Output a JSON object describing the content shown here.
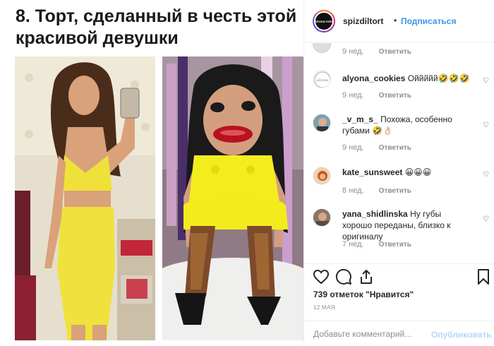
{
  "article": {
    "headline_line1": "8. Торт, сделанный в честь этой",
    "headline_line2": "красивой девушки"
  },
  "post": {
    "username": "spizdiltort",
    "dot": "•",
    "follow_label": "Подписаться",
    "avatar_text": "SPIZDILTORT"
  },
  "comments": [
    {
      "username": "",
      "text": "",
      "time": "9 нед.",
      "reply": "Ответить"
    },
    {
      "username": "alyona_cookies",
      "text": "Оййййй🤣🤣🤣",
      "time": "9 нед.",
      "reply": "Ответить"
    },
    {
      "username": "_v_m_s_",
      "text": "Похожа, особенно губами 🤣👌🏻",
      "time": "9 нед.",
      "reply": "Ответить"
    },
    {
      "username": "kate_sunsweet",
      "text": "😀😀😀",
      "time": "8 нед.",
      "reply": "Ответить"
    },
    {
      "username": "yana_shidlinska",
      "text": "Ну губы хорошо переданы, близко к оригиналу",
      "time": "7 нед.",
      "reply": "Ответить"
    }
  ],
  "footer": {
    "likes": "739 отметок \"Нравится\"",
    "date": "12 МАЯ",
    "comment_placeholder": "Добавьте комментарий...",
    "publish_label": "Опубликовать"
  },
  "icons": [
    "like-heart-icon",
    "comment-icon",
    "share-icon",
    "bookmark-icon",
    "comment-heart-icon"
  ],
  "colors": {
    "link_blue": "#3897f0",
    "publish_disabled": "#b3d7fb",
    "muted": "#8e8e8e"
  }
}
